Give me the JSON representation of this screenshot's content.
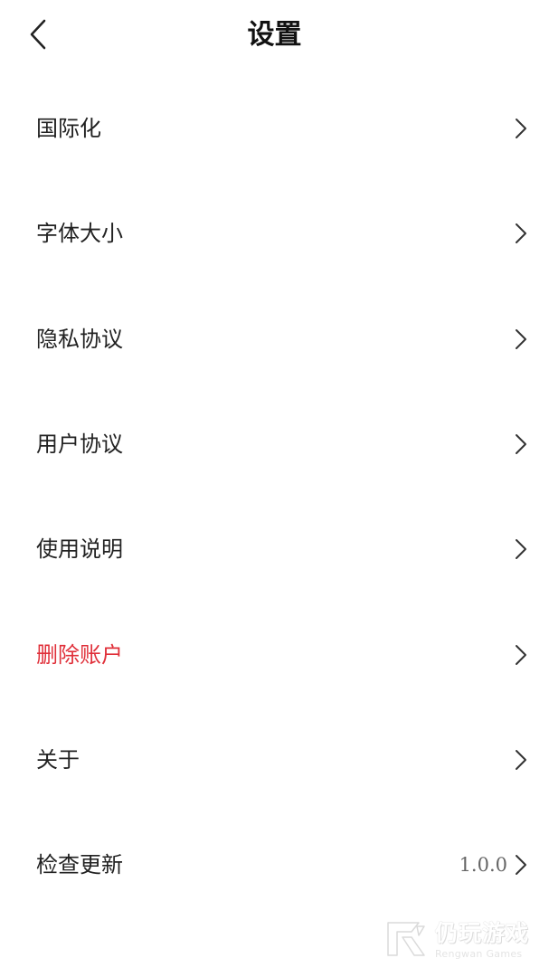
{
  "header": {
    "title": "设置"
  },
  "settings": {
    "items": [
      {
        "label": "国际化",
        "value": ""
      },
      {
        "label": "字体大小",
        "value": ""
      },
      {
        "label": "隐私协议",
        "value": ""
      },
      {
        "label": "用户协议",
        "value": ""
      },
      {
        "label": "使用说明",
        "value": ""
      },
      {
        "label": "删除账户",
        "value": "",
        "color": "#e0303a"
      },
      {
        "label": "关于",
        "value": ""
      },
      {
        "label": "检查更新",
        "value": "1.0.0"
      }
    ]
  },
  "watermark": {
    "name": "仍玩游戏",
    "subtitle": "Rengwan Games"
  },
  "colors": {
    "danger": "#e0303a",
    "text": "#222222",
    "secondary_text": "#666666",
    "background": "#ffffff"
  },
  "icons": {
    "back": "chevron-left-icon",
    "row_arrow": "chevron-right-icon"
  }
}
